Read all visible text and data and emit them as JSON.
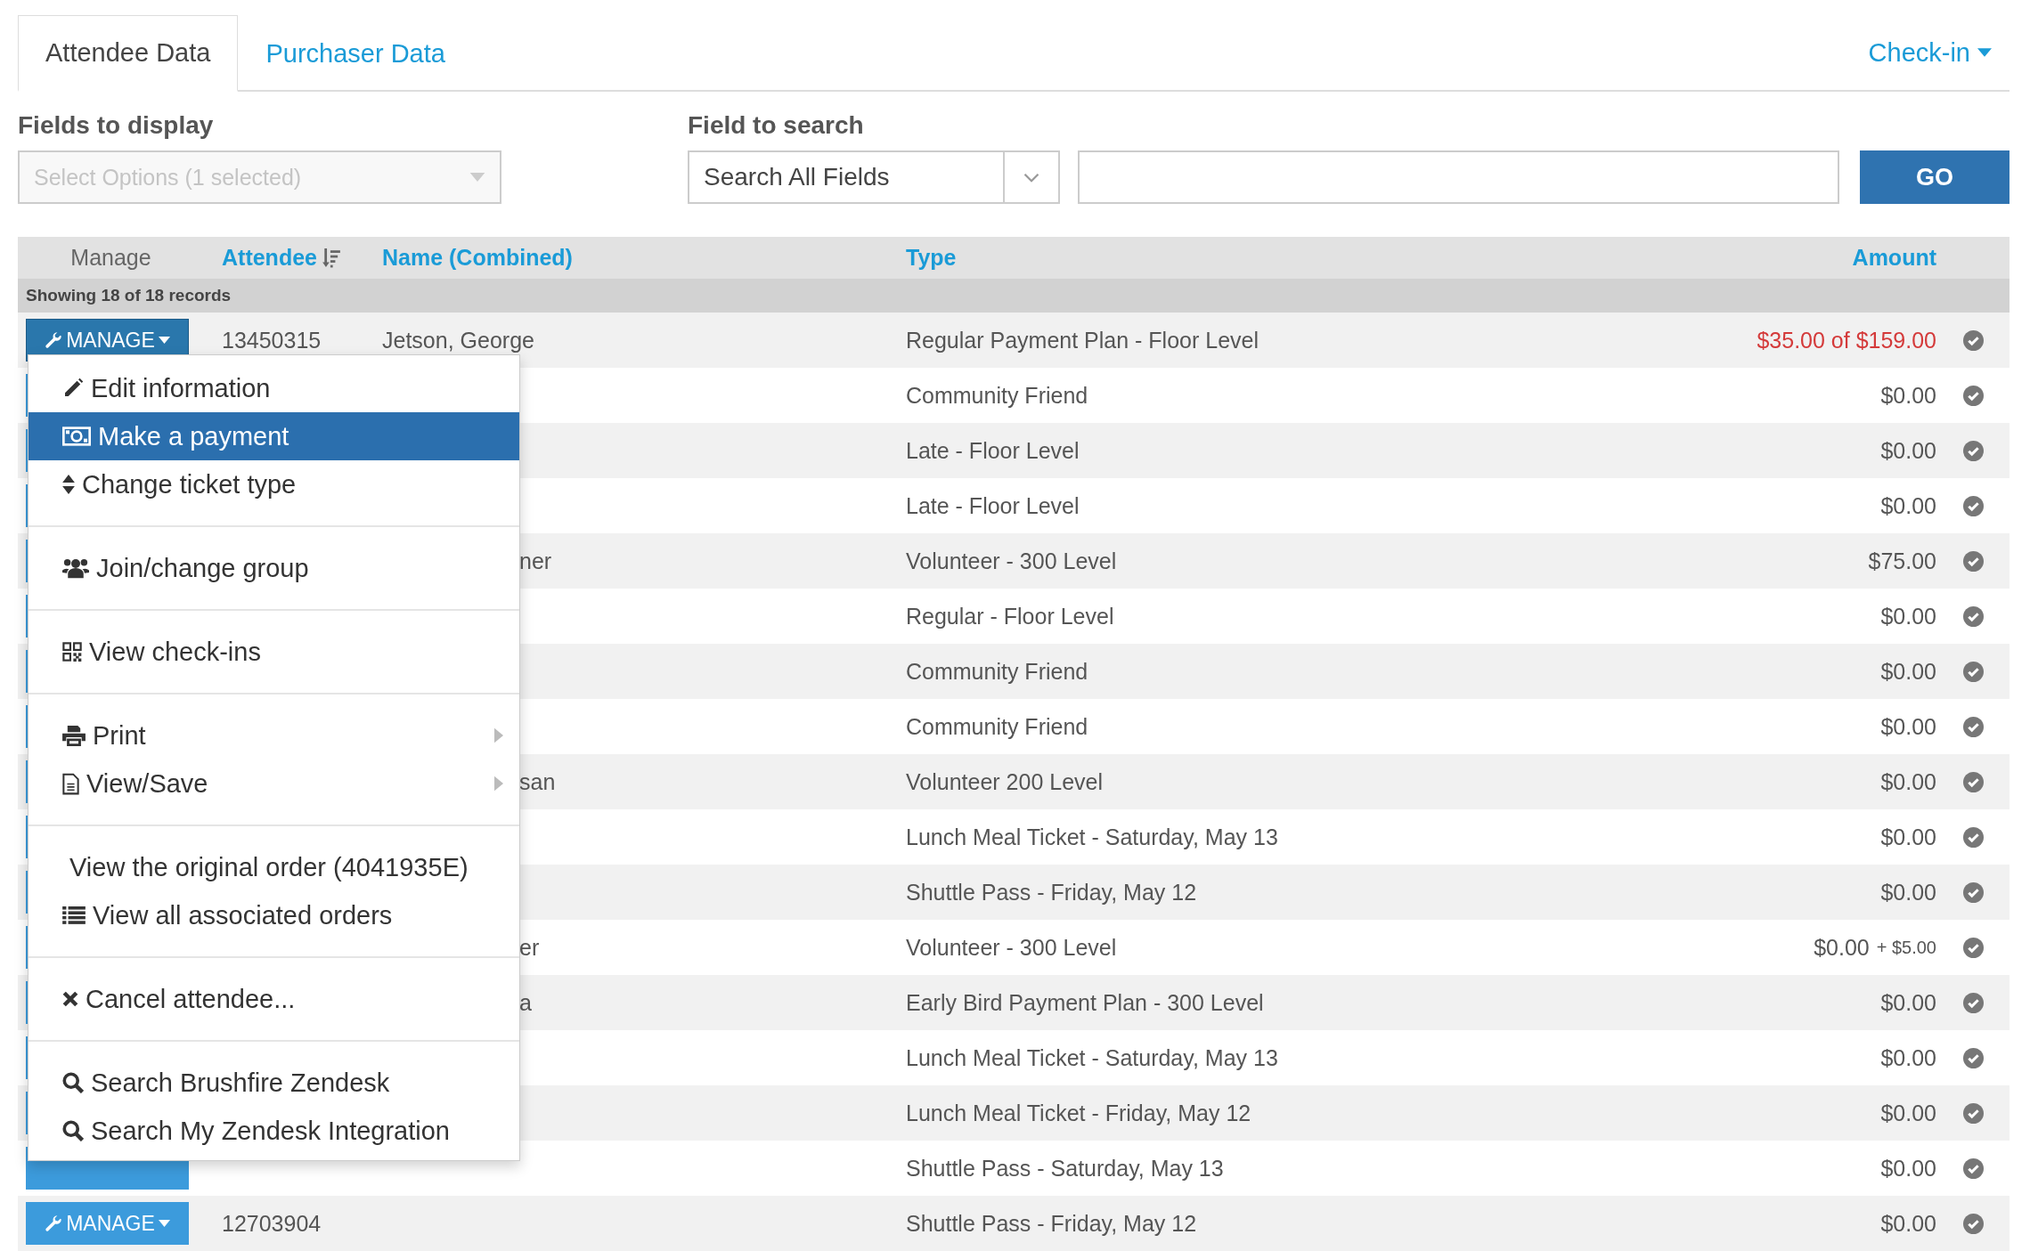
{
  "tabs": [
    {
      "label": "Attendee Data",
      "selected": true
    },
    {
      "label": "Purchaser Data",
      "selected": false
    }
  ],
  "checkin_menu": {
    "label": "Check-in"
  },
  "fields_to_display": {
    "label": "Fields to display",
    "placeholder": "Select Options (1 selected)"
  },
  "field_to_search": {
    "label": "Field to search",
    "value": "Search All Fields"
  },
  "search_button": "GO",
  "table": {
    "columns": [
      {
        "label": "Manage",
        "kind": "plain",
        "sortable": false
      },
      {
        "label": "Attendee",
        "kind": "link",
        "sortable": true
      },
      {
        "label": "Name (Combined)",
        "kind": "link",
        "sortable": false
      },
      {
        "label": "Type",
        "kind": "link",
        "sortable": false
      },
      {
        "label": "Amount",
        "kind": "link",
        "sortable": false
      }
    ],
    "record_count": "Showing 18 of 18 records",
    "rows": [
      {
        "kind": "full",
        "manage": "MANAGE",
        "open": true,
        "attendee": "13450315",
        "name": "Jetson, George",
        "type": "Regular Payment Plan - Floor Level",
        "amount": "$35.00 of $159.00",
        "balance_due": true
      },
      {
        "kind": "covered",
        "open": false,
        "type": "Community Friend",
        "amount": "$0.00",
        "balance_due": false
      },
      {
        "kind": "covered",
        "open": false,
        "type": "Late - Floor Level",
        "amount": "$0.00",
        "balance_due": false
      },
      {
        "kind": "covered",
        "open": false,
        "type": "Late - Floor Level",
        "amount": "$0.00",
        "balance_due": false
      },
      {
        "kind": "covered",
        "open": false,
        "name_fragment": "ner",
        "type": "Volunteer - 300 Level",
        "amount": "$75.00",
        "balance_due": false
      },
      {
        "kind": "covered",
        "open": false,
        "type": "Regular - Floor Level",
        "amount": "$0.00",
        "balance_due": false
      },
      {
        "kind": "covered",
        "open": false,
        "type": "Community Friend",
        "amount": "$0.00",
        "balance_due": false
      },
      {
        "kind": "covered",
        "open": false,
        "type": "Community Friend",
        "amount": "$0.00",
        "balance_due": false
      },
      {
        "kind": "covered",
        "open": false,
        "name_fragment": "san",
        "type": "Volunteer 200 Level",
        "amount": "$0.00",
        "balance_due": false
      },
      {
        "kind": "covered",
        "open": false,
        "type": "Lunch Meal Ticket - Saturday, May 13",
        "amount": "$0.00",
        "balance_due": false
      },
      {
        "kind": "covered",
        "open": false,
        "type": "Shuttle Pass - Friday, May 12",
        "amount": "$0.00",
        "balance_due": false
      },
      {
        "kind": "covered",
        "open": false,
        "name_fragment": "er",
        "type": "Volunteer - 300 Level",
        "amount": "$0.00",
        "amount_extra": "+ $5.00",
        "balance_due": false
      },
      {
        "kind": "covered",
        "open": false,
        "name_fragment": "a",
        "type": "Early Bird Payment Plan - 300 Level",
        "amount": "$0.00",
        "balance_due": false
      },
      {
        "kind": "covered",
        "open": false,
        "type": "Lunch Meal Ticket - Saturday, May 13",
        "amount": "$0.00",
        "balance_due": false
      },
      {
        "kind": "covered",
        "open": false,
        "type": "Lunch Meal Ticket - Friday, May 12",
        "amount": "$0.00",
        "balance_due": false
      },
      {
        "kind": "covered",
        "open": false,
        "type": "Shuttle Pass - Saturday, May 13",
        "amount": "$0.00",
        "balance_due": false
      },
      {
        "kind": "full",
        "manage": "MANAGE",
        "open": false,
        "attendee": "12703904",
        "type": "Shuttle Pass - Friday, May 12",
        "amount": "$0.00",
        "balance_due": false
      }
    ]
  },
  "manage_menu": {
    "groups": [
      {
        "items": [
          {
            "label": "Edit information",
            "selected": false,
            "submenu": false
          },
          {
            "label": "Make a payment",
            "selected": true,
            "submenu": false
          },
          {
            "label": "Change ticket type",
            "selected": false,
            "submenu": false
          }
        ]
      },
      {
        "items": [
          {
            "label": "Join/change group",
            "selected": false,
            "submenu": false
          }
        ]
      },
      {
        "items": [
          {
            "label": "View check-ins",
            "selected": false,
            "submenu": false
          }
        ]
      },
      {
        "items": [
          {
            "label": "Print",
            "selected": false,
            "submenu": true
          },
          {
            "label": "View/Save",
            "selected": false,
            "submenu": true
          }
        ]
      },
      {
        "items": [
          {
            "label": "View the original order (4041935E)",
            "selected": false,
            "submenu": false
          },
          {
            "label": "View all associated orders",
            "selected": false,
            "submenu": false
          }
        ]
      },
      {
        "items": [
          {
            "label": "Cancel attendee...",
            "selected": false,
            "submenu": false
          }
        ]
      },
      {
        "items": [
          {
            "label": "Search Brushfire Zendesk",
            "selected": false,
            "submenu": false
          },
          {
            "label": "Search My Zendesk Integration",
            "selected": false,
            "submenu": false
          }
        ]
      }
    ]
  }
}
